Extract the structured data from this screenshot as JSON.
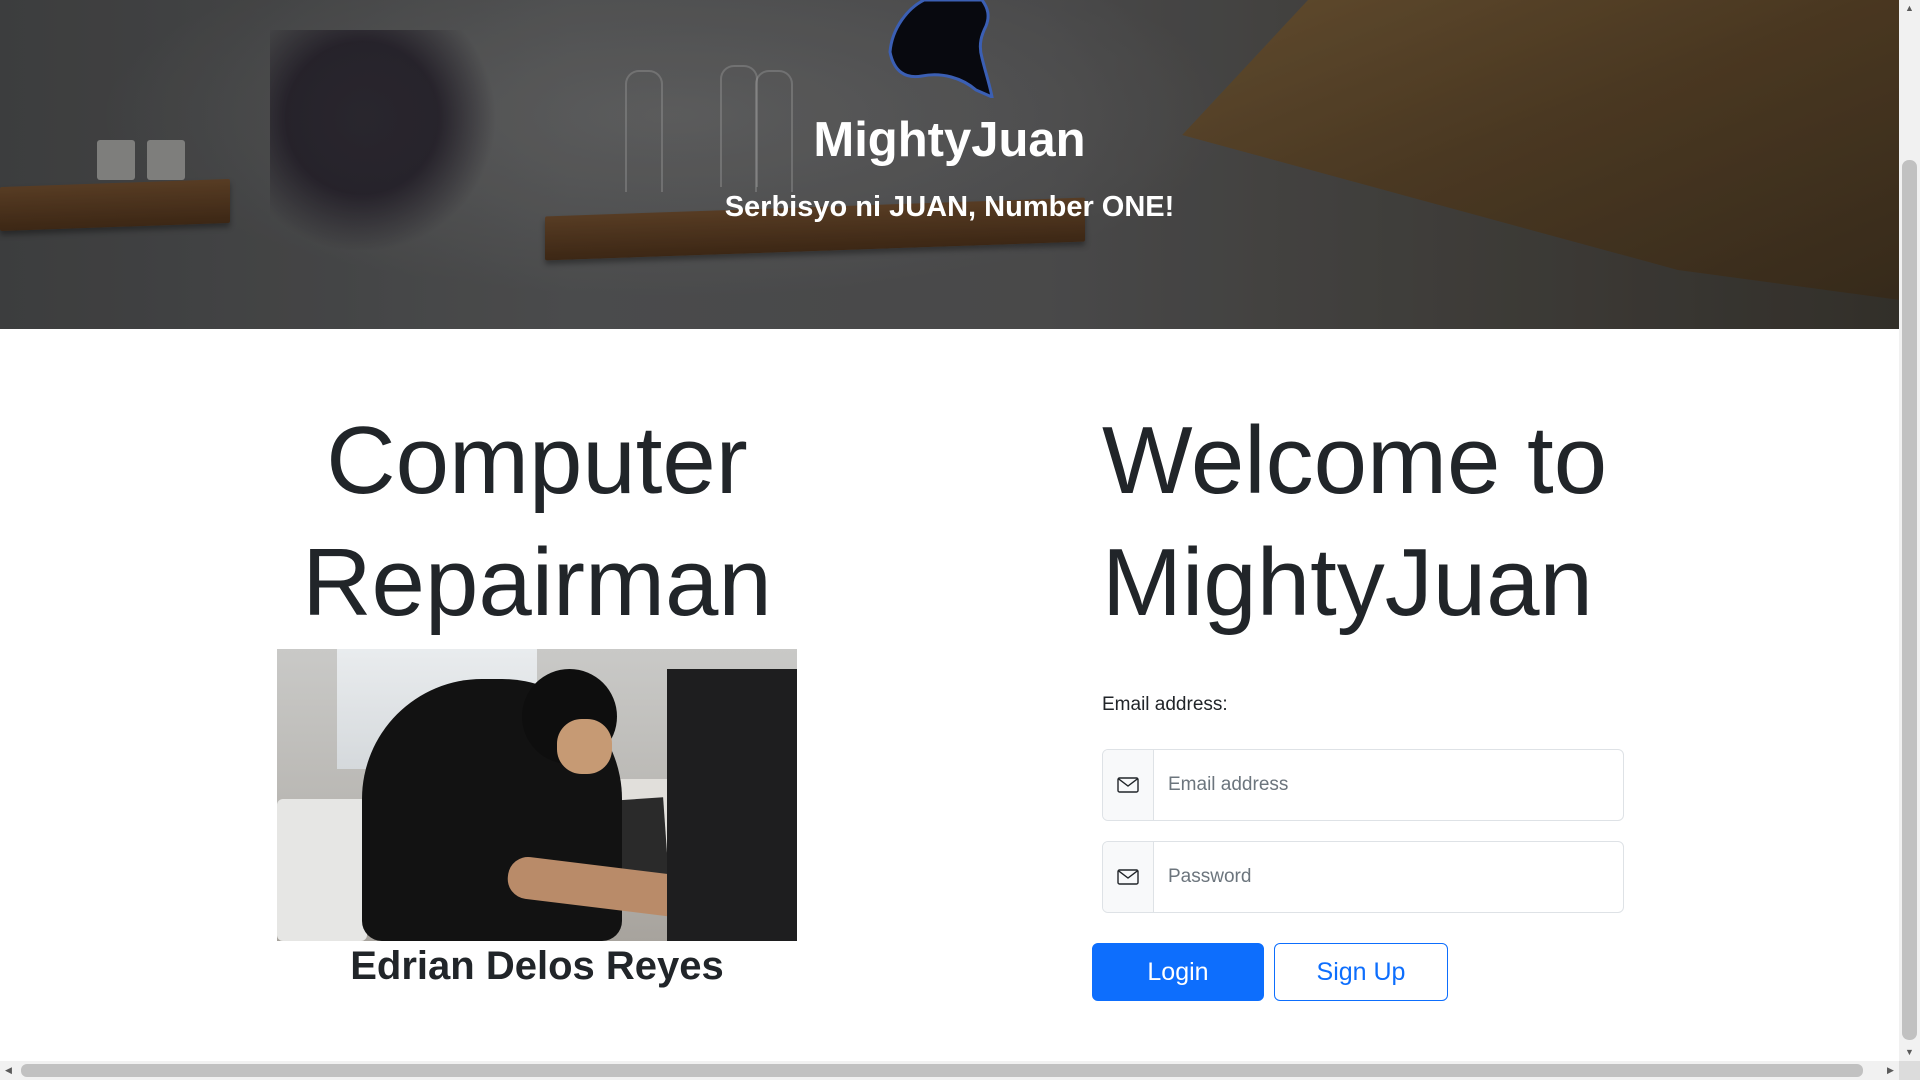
{
  "hero": {
    "title": "MightyJuan",
    "tagline": "Serbisyo ni JUAN, Number ONE!",
    "logo_icon": "flexed-arm-icon"
  },
  "featured": {
    "heading_line1": "Computer",
    "heading_line2": "Repairman",
    "photo_icon": "repairman-photo",
    "caption": "Edrian Delos Reyes"
  },
  "login": {
    "heading_line1": "Welcome to",
    "heading_line2": "MightyJuan",
    "email_label": "Email address:",
    "email_placeholder": "Email address",
    "email_value": "",
    "password_placeholder": "Password",
    "password_value": "",
    "field_icon": "envelope-icon",
    "login_label": "Login",
    "signup_label": "Sign Up"
  },
  "colors": {
    "primary": "#0d6efd",
    "text": "#212529",
    "muted": "#6c757d",
    "border": "#dee2e6"
  }
}
